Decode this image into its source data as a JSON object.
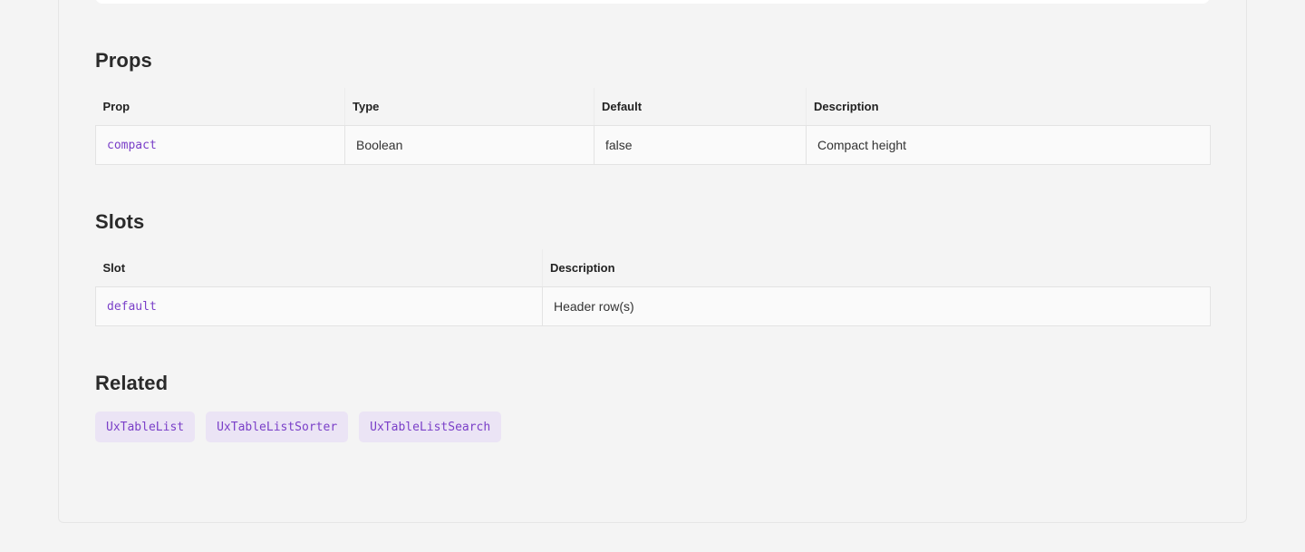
{
  "props": {
    "title": "Props",
    "headers": [
      "Prop",
      "Type",
      "Default",
      "Description"
    ],
    "rows": [
      {
        "prop": "compact",
        "type": "Boolean",
        "default": "false",
        "description": "Compact height"
      }
    ]
  },
  "slots": {
    "title": "Slots",
    "headers": [
      "Slot",
      "Description"
    ],
    "rows": [
      {
        "slot": "default",
        "description": "Header row(s)"
      }
    ]
  },
  "related": {
    "title": "Related",
    "items": [
      "UxTableList",
      "UxTableListSorter",
      "UxTableListSearch"
    ]
  },
  "colors": {
    "accent": "#7a3fc8",
    "chip_bg": "#ebe4f5"
  }
}
